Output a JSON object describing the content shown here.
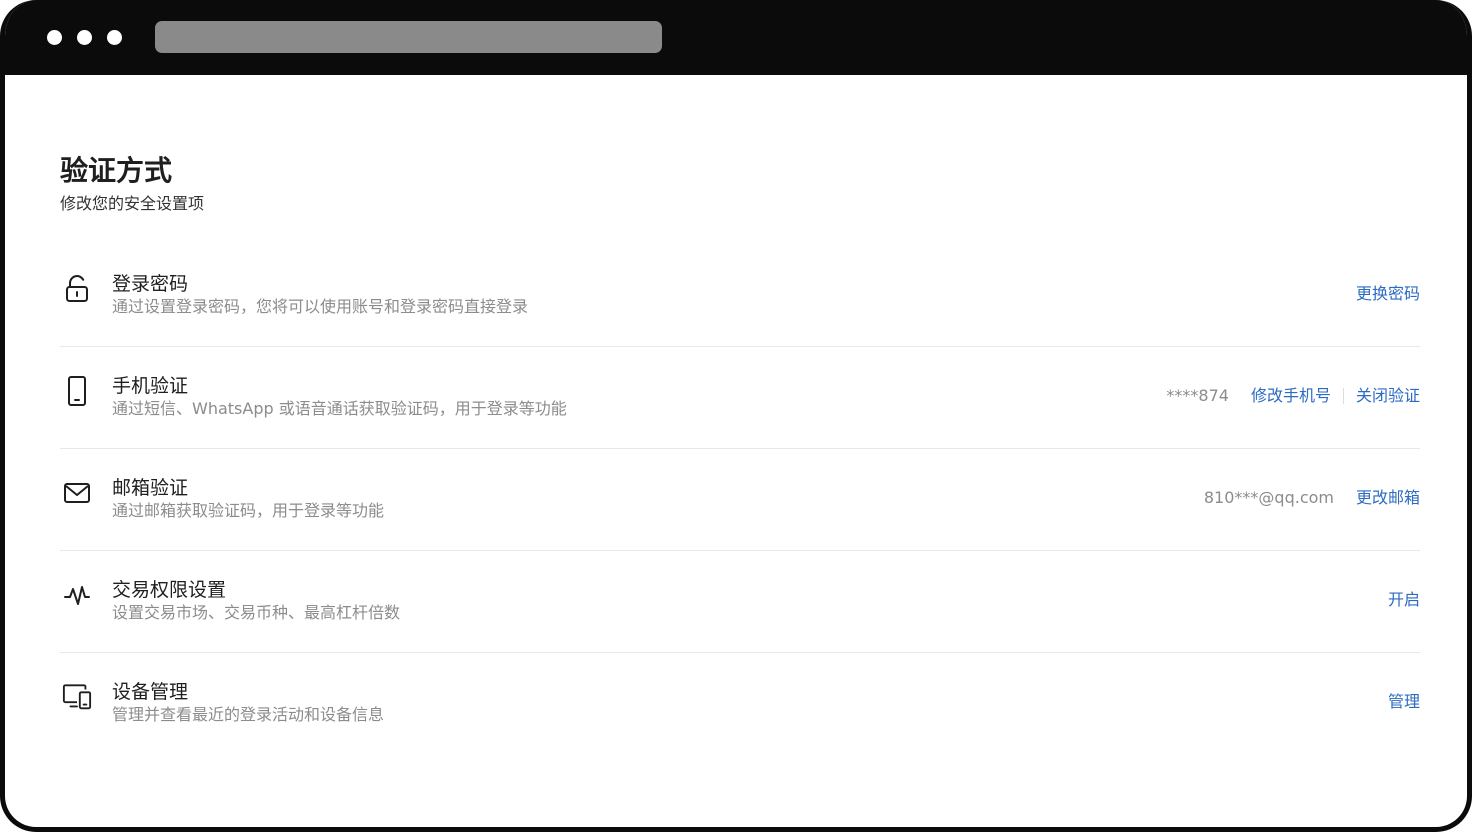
{
  "page": {
    "title": "验证方式",
    "subtitle": "修改您的安全设置项"
  },
  "theme": {
    "link_color": "#2c6bc1",
    "muted_text_color": "#8c8c8c",
    "title_bar_color": "#0b0b0b"
  },
  "security_items": [
    {
      "icon": "unlock-icon",
      "title": "登录密码",
      "description": "通过设置登录密码，您将可以使用账号和登录密码直接登录",
      "actions": [
        "更换密码"
      ]
    },
    {
      "icon": "mobile-phone-icon",
      "title": "手机验证",
      "description": "通过短信、WhatsApp 或语音通话获取验证码，用于登录等功能",
      "masked_value": "****874",
      "actions": [
        "修改手机号",
        "关闭验证"
      ]
    },
    {
      "icon": "mail-icon",
      "title": "邮箱验证",
      "description": "通过邮箱获取验证码，用于登录等功能",
      "masked_value": "810***@qq.com",
      "actions": [
        "更改邮箱"
      ]
    },
    {
      "icon": "activity-icon",
      "title": "交易权限设置",
      "description": "设置交易市场、交易币种、最高杠杆倍数",
      "actions": [
        "开启"
      ]
    },
    {
      "icon": "devices-icon",
      "title": "设备管理",
      "description": "管理并查看最近的登录活动和设备信息",
      "actions": [
        "管理"
      ]
    }
  ]
}
